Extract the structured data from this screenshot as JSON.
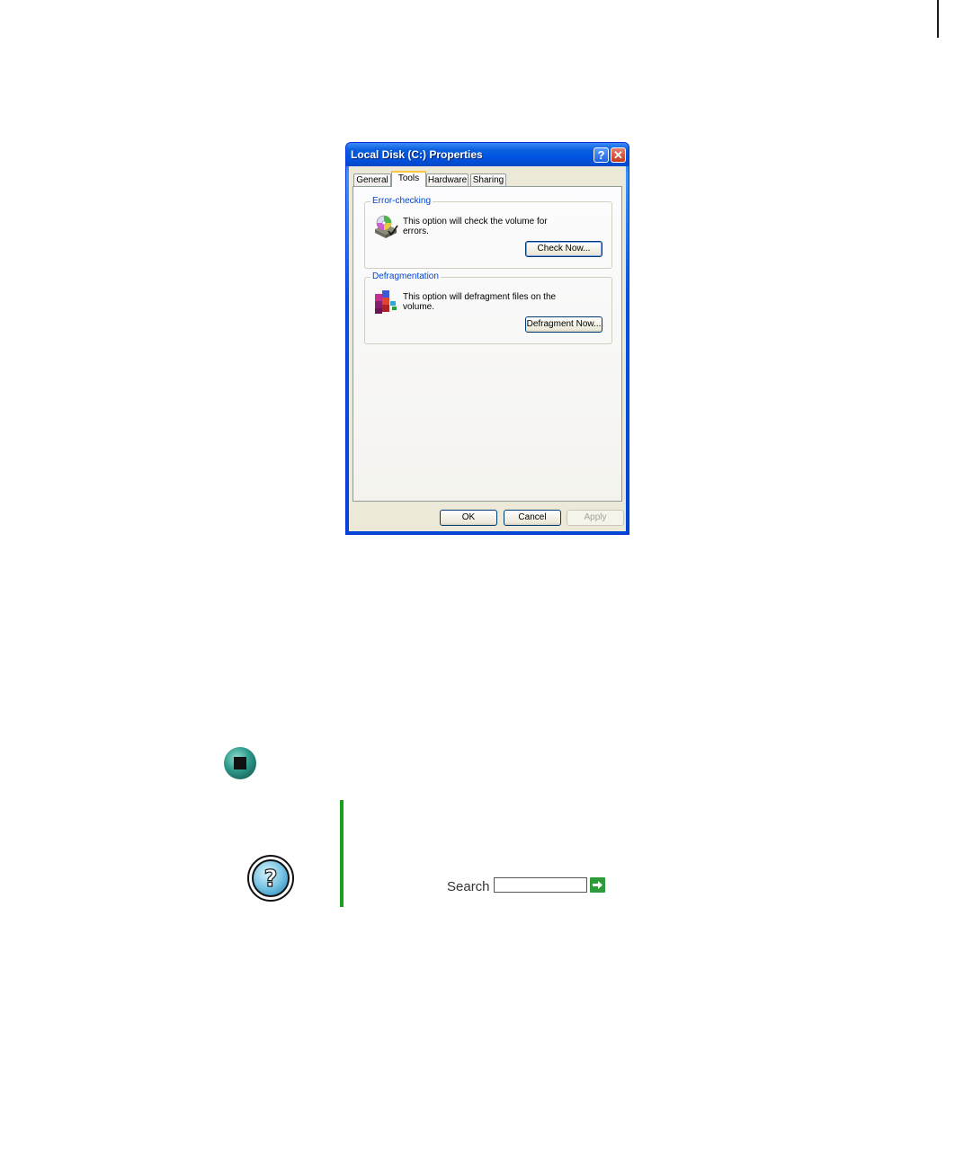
{
  "dialog": {
    "title": "Local Disk (C:) Properties",
    "help_glyph": "?",
    "close_glyph": "✕",
    "tabs": [
      {
        "label": "General"
      },
      {
        "label": "Tools"
      },
      {
        "label": "Hardware"
      },
      {
        "label": "Sharing"
      }
    ],
    "active_tab": "Tools",
    "error_checking": {
      "label": "Error-checking",
      "text": "This option will check the volume for errors.",
      "button": "Check Now...",
      "icon": "disk-check-icon"
    },
    "defragmentation": {
      "label": "Defragmentation",
      "text": "This option will defragment files on the volume.",
      "button": "Defragment Now...",
      "icon": "defragment-icon"
    },
    "footer": {
      "ok": "OK",
      "cancel": "Cancel",
      "apply": "Apply"
    }
  },
  "page": {
    "stop_icon": "stop-icon",
    "help_icon": "help-icon",
    "search_label": "Search",
    "search_value": "",
    "search_go_icon": "arrow-right-icon",
    "accent_green": "#1aa01a"
  }
}
